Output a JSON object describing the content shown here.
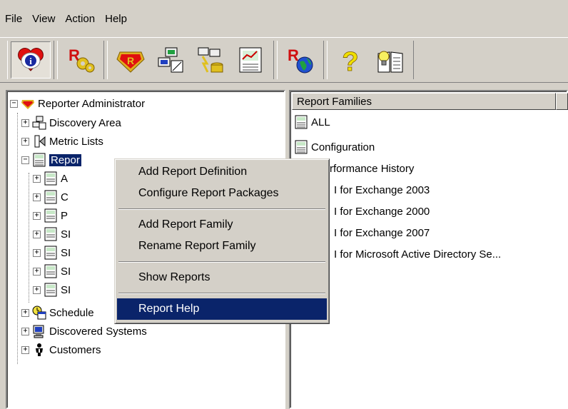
{
  "menubar": {
    "items": [
      {
        "label": "File"
      },
      {
        "label": "View"
      },
      {
        "label": "Action"
      },
      {
        "label": "Help"
      }
    ]
  },
  "toolbar": {
    "buttons": [
      {
        "icon": "info-heart-icon"
      },
      {
        "icon": "reporter-gear-icon"
      },
      {
        "icon": "reporter-logo-icon"
      },
      {
        "icon": "discovery-area-icon"
      },
      {
        "icon": "run-discovery-icon"
      },
      {
        "icon": "chart-report-icon"
      },
      {
        "icon": "reporter-globe-icon"
      },
      {
        "icon": "help-question-icon"
      },
      {
        "icon": "book-idea-icon"
      }
    ]
  },
  "tree": {
    "root": "Reporter Administrator",
    "nodes": [
      {
        "label": "Discovery Area"
      },
      {
        "label": "Metric Lists"
      },
      {
        "label": "Repor"
      },
      {
        "label": "A"
      },
      {
        "label": "C"
      },
      {
        "label": "P"
      },
      {
        "label": "SI"
      },
      {
        "label": "SI"
      },
      {
        "label": "SI"
      },
      {
        "label": "SI"
      },
      {
        "label": "Schedule"
      },
      {
        "label": "Discovered Systems"
      },
      {
        "label": "Customers"
      }
    ]
  },
  "list": {
    "column_header": "Report Families",
    "items": [
      {
        "label": "ALL"
      },
      {
        "label": "Configuration"
      },
      {
        "label": "rformance History"
      },
      {
        "label": "I for Exchange  2003"
      },
      {
        "label": "I for Exchange 2000"
      },
      {
        "label": "I for Exchange 2007"
      },
      {
        "label": "I for Microsoft Active Directory Se..."
      }
    ]
  },
  "context_menu": {
    "items": [
      {
        "label": "Add Report Definition"
      },
      {
        "label": "Configure Report Packages"
      },
      {
        "label": "Add Report Family"
      },
      {
        "label": "Rename Report Family"
      },
      {
        "label": "Show Reports"
      },
      {
        "label": "Report Help"
      }
    ]
  }
}
